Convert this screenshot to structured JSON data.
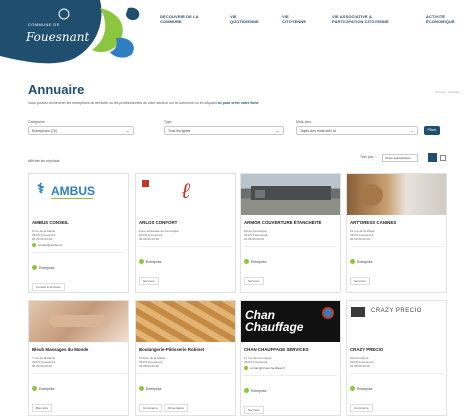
{
  "header": {
    "logo_line1": "COMMUNE DE",
    "logo_line2": "Fouesnant",
    "nav": [
      "DÉCOUVRIR DE LA COMMUNE",
      "VIE QUOTIDIENNE",
      "VIE CITOYENNE",
      "VIE ASSOCIATIVE & PARTICIPATION CITOYENNE",
      "ACTIVITÉ ÉCONOMIQUE"
    ]
  },
  "page": {
    "title": "Annuaire",
    "breadcrumb": "Accueil > Annuaire",
    "intro": "Vous pouvez rechercher les entreprises du territoire ou les professionnels de votre secteur sur la commune ou en cliquant",
    "intro_link": "ici pour créer votre fiche"
  },
  "filters": {
    "category_label": "Catégories",
    "category_value": "Entreprises (76)",
    "type_label": "Type",
    "type_value": "Tous les types",
    "keywords_label": "Mots-clés",
    "keywords_value": "Tapez des mots-clés ici",
    "submit": "Filtrer"
  },
  "results": {
    "count": "Afficher les résultats",
    "sort_label": "Trier par :",
    "sort_value": "Ordre alphabétique"
  },
  "cards": [
    {
      "name": "AMBUS CONSEIL",
      "img_text": "AMBUS",
      "lines": [
        "6 rue de la Mairie",
        "29170 Fouesnant",
        "06 00 00 00 00"
      ],
      "email": "contact@ambus.fr",
      "badge": "Entreprise",
      "tags": [
        "Conseil & services"
      ]
    },
    {
      "name": "ARLOS CONFORT",
      "img_text": "Arlos Confort",
      "lines": [
        "Zone artisanale de Kerourgué",
        "29170 Fouesnant",
        "02 98 00 00 00"
      ],
      "email": "",
      "badge": "Entreprise",
      "tags": [
        "Services"
      ]
    },
    {
      "name": "ARMOR COUVERTURE ÉTANCHÉITÉ",
      "img_text": "",
      "lines": [
        "ZA de Kerourgué",
        "29170 Fouesnant",
        "02 98 00 00 00"
      ],
      "email": "",
      "badge": "Entreprise",
      "tags": [
        "Services"
      ]
    },
    {
      "name": "ART'DRESS CANINES",
      "img_text": "",
      "lines": [
        "22 rue de la Plage",
        "29170 Fouesnant",
        "06 00 00 00 00"
      ],
      "email": "",
      "badge": "Entreprise",
      "tags": [
        "Services"
      ]
    },
    {
      "name": "Bleuh Massages du Monde",
      "img_text": "",
      "lines": [
        "7 rue de la Mairie",
        "29170 Fouesnant",
        "06 00 00 00 00"
      ],
      "email": "",
      "badge": "Entreprise",
      "tags": [
        "Bien-être"
      ]
    },
    {
      "name": "Boulangerie-Pâtisserie Robinet",
      "img_text": "",
      "lines": [
        "6 Place de la Mairie",
        "29170 Fouesnant",
        "02 98 00 00 00"
      ],
      "email": "",
      "badge": "Entreprise",
      "tags": [
        "Commerce",
        "Alimentation"
      ]
    },
    {
      "name": "CHAN CHAUFFAGE SERVICES",
      "img_text": "Chan Chauffage",
      "lines": [
        "17 rue de Kerourgué",
        "29170 Fouesnant"
      ],
      "email": "contact@chanchauffage.fr",
      "badge": "Entreprise",
      "tags": [
        "Services"
      ]
    },
    {
      "name": "CRAZY PRECIO",
      "img_text": "CRAZY PRECIO",
      "lines": [
        "ZA Kerourgué",
        "29170 Fouesnant",
        "02 98 00 00 00"
      ],
      "email": "",
      "badge": "Entreprise",
      "tags": [
        "Commerce"
      ]
    }
  ]
}
